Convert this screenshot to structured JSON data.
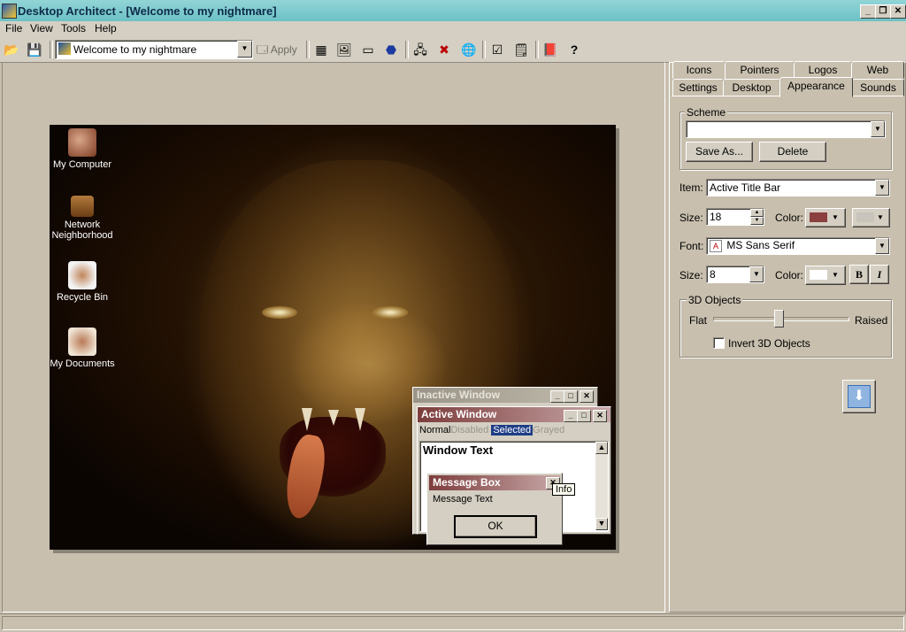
{
  "window": {
    "title": "Desktop Architect - [Welcome to my nightmare]",
    "controls": [
      "_",
      "❐",
      "✕"
    ]
  },
  "menu": [
    "File",
    "View",
    "Tools",
    "Help"
  ],
  "toolbar": {
    "theme_combo_value": "Welcome to my nightmare",
    "apply_label": "Apply"
  },
  "desktop_icons": [
    {
      "label": "My Computer",
      "icon": "my-computer-icon"
    },
    {
      "label": "Network Neighborhood",
      "icon": "network-neighborhood-icon"
    },
    {
      "label": "Recycle Bin",
      "icon": "recycle-bin-icon"
    },
    {
      "label": "My Documents",
      "icon": "my-documents-icon"
    }
  ],
  "preview": {
    "inactive_title": "Inactive Window",
    "active_title": "Active Window",
    "menu_states": [
      "Normal",
      "Disabled",
      "Selected",
      "Grayed"
    ],
    "window_text": "Window Text",
    "msgbox_title": "Message Box",
    "msgbox_text": "Message Text",
    "ok_label": "OK",
    "tooltip": "Info"
  },
  "tabs_row1": [
    "Icons",
    "Pointers",
    "Logos",
    "Web"
  ],
  "tabs_row2": [
    "Settings",
    "Desktop",
    "Appearance",
    "Sounds"
  ],
  "appearance": {
    "scheme_label": "Scheme",
    "scheme_value": "",
    "save_as_label": "Save As...",
    "delete_label": "Delete",
    "item_label": "Item:",
    "item_value": "Active Title Bar",
    "size_label": "Size:",
    "size_value": "18",
    "color_label": "Color:",
    "color1": "#8b3f3f",
    "color2": "#c8c4bc",
    "font_label": "Font:",
    "font_value": "MS Sans Serif",
    "font_size_label": "Size:",
    "font_size_value": "8",
    "font_color_label": "Color:",
    "font_color": "#ffffff",
    "bold_label": "B",
    "italic_label": "I",
    "objects_label": "3D Objects",
    "flat_label": "Flat",
    "raised_label": "Raised",
    "slider_position": 0.48,
    "invert_label": "Invert 3D Objects",
    "invert_checked": false
  }
}
